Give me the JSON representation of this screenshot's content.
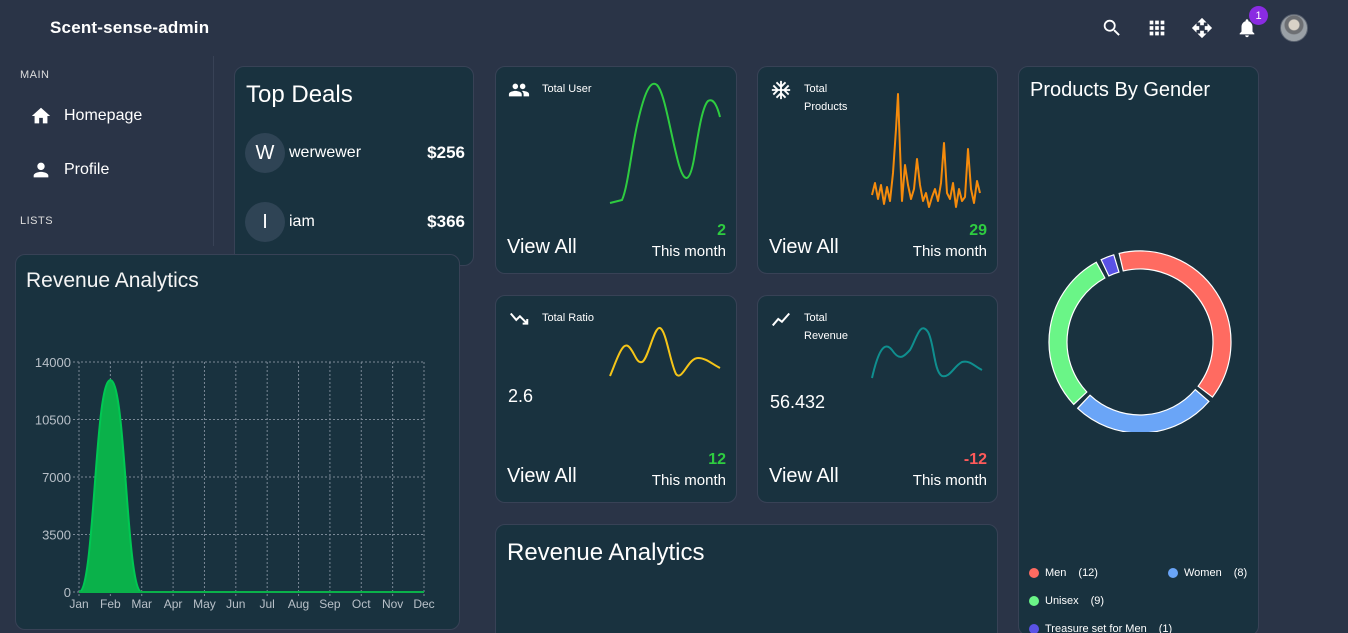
{
  "app": {
    "title": "Scent-sense-admin"
  },
  "navbar": {
    "icons": [
      "search-icon",
      "apps-icon",
      "move-icon",
      "notification-icon"
    ],
    "notification_count": "1"
  },
  "sidebar": {
    "main_title": "MAIN",
    "items": [
      {
        "label": "Homepage",
        "icon": "home-icon"
      },
      {
        "label": "Profile",
        "icon": "person-icon"
      }
    ],
    "lists_title": "LISTS"
  },
  "top_deals": {
    "title": "Top Deals",
    "deals": [
      {
        "initial": "W",
        "name": "werwewer",
        "amount": "$256"
      },
      {
        "initial": "I",
        "name": "iam",
        "amount": "$366"
      }
    ]
  },
  "stats": {
    "total_user": {
      "label": "Total User",
      "percent": "2",
      "period": "This month",
      "view_all": "View All",
      "color": "#2ecc40",
      "icon": "users-icon"
    },
    "total_products": {
      "label": "Total Products",
      "percent": "29",
      "period": "This month",
      "view_all": "View All",
      "color": "#f58b0c",
      "icon": "snowflake-icon"
    },
    "total_ratio": {
      "label": "Total Ratio",
      "value": "2.6",
      "percent": "12",
      "period": "This month",
      "view_all": "View All",
      "color": "#f5c518",
      "icon": "trending-down-icon"
    },
    "total_revenue": {
      "label": "Total Revenue",
      "value": "56.432",
      "percent": "-12",
      "period": "This month",
      "view_all": "View All",
      "color": "#0f8f8f",
      "icon": "trending-up-icon"
    }
  },
  "colors": {
    "positive": "#2ecc40",
    "negative": "#ff5a5a"
  },
  "products_by_gender": {
    "title": "Products By Gender",
    "segments": [
      {
        "name": "Men",
        "value": 12,
        "color": "#ff6b61"
      },
      {
        "name": "Women",
        "value": 8,
        "color": "#6aa5f7"
      },
      {
        "name": "Unisex",
        "value": 9,
        "color": "#6af587"
      },
      {
        "name": "Treasure set for Men",
        "value": 1,
        "color": "#5a52e6"
      }
    ]
  },
  "revenue_analytics_panel": {
    "title": "Revenue Analytics"
  },
  "revenue_analytics_card": {
    "title": "Revenue Analytics"
  },
  "chart_data": [
    {
      "type": "area",
      "categories": [
        "Jan",
        "Feb",
        "Mar",
        "Apr",
        "May",
        "Jun",
        "Jul",
        "Aug",
        "Sep",
        "Oct",
        "Nov",
        "Dec"
      ],
      "values": [
        0,
        12900,
        0,
        0,
        0,
        0,
        0,
        0,
        0,
        0,
        0,
        0
      ],
      "yticks": [
        0,
        3500,
        7000,
        10500,
        14000
      ],
      "ylim": [
        0,
        14000
      ],
      "grid": true,
      "color": "#0ab14a"
    },
    {
      "type": "pie",
      "labels": [
        "Men",
        "Women",
        "Unisex",
        "Treasure set for Men"
      ],
      "values": [
        12,
        8,
        9,
        1
      ]
    }
  ]
}
